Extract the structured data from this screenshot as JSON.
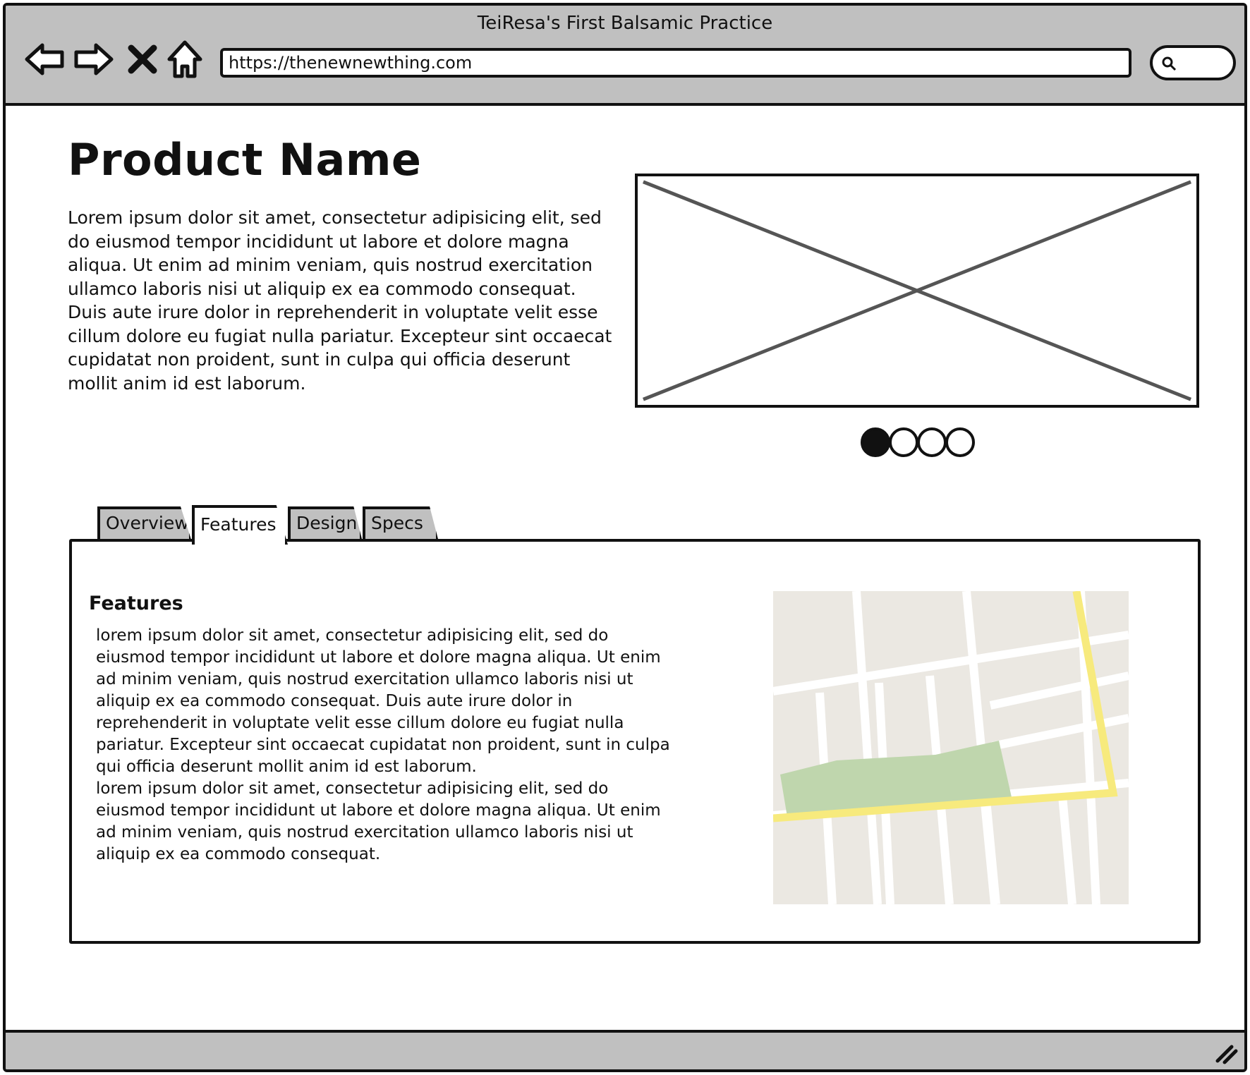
{
  "window": {
    "title": "TeiResa's First Balsamic Practice"
  },
  "toolbar": {
    "back_icon": "back-arrow-icon",
    "forward_icon": "forward-arrow-icon",
    "stop_icon": "close-icon",
    "home_icon": "home-icon",
    "url": "https://thenewnewthing.com",
    "search_icon": "search-icon"
  },
  "product": {
    "name": "Product Name",
    "description": "Lorem ipsum dolor sit amet, consectetur adipisicing elit, sed do eiusmod tempor incididunt ut labore et dolore magna aliqua. Ut enim ad minim veniam, quis nostrud exercitation ullamco laboris nisi ut aliquip ex ea commodo consequat. Duis aute irure dolor in reprehenderit in voluptate velit esse cillum dolore eu fugiat nulla pariatur. Excepteur sint occaecat cupidatat non proident, sunt in culpa qui officia deserunt mollit anim id est laborum."
  },
  "carousel": {
    "count": 4,
    "active_index": 0
  },
  "tabs": [
    {
      "label": "Overview",
      "active": false
    },
    {
      "label": "Features",
      "active": true
    },
    {
      "label": "Design",
      "active": false
    },
    {
      "label": "Specs",
      "active": false
    }
  ],
  "panel": {
    "heading": "Features",
    "paragraph_1": "lorem ipsum dolor sit amet, consectetur adipisicing elit, sed do eiusmod tempor incididunt ut labore et dolore magna aliqua. Ut enim ad minim veniam, quis nostrud exercitation ullamco laboris nisi ut aliquip ex ea commodo consequat. Duis aute irure dolor in reprehenderit in voluptate velit esse cillum dolore eu fugiat nulla pariatur. Excepteur sint occaecat cupidatat non proident, sunt in culpa qui officia deserunt mollit anim id est laborum.",
    "paragraph_2": "lorem ipsum dolor sit amet, consectetur adipisicing elit, sed do eiusmod tempor incididunt ut labore et dolore magna aliqua. Ut enim ad minim veniam, quis nostrud exercitation ullamco laboris nisi ut aliquip ex ea commodo consequat."
  },
  "colors": {
    "chrome": "#c0c0c0",
    "map_block": "#ebe8e2",
    "map_park": "#bfd6ad",
    "map_route": "#f7ea7d",
    "placeholder_cross": "#555555"
  }
}
